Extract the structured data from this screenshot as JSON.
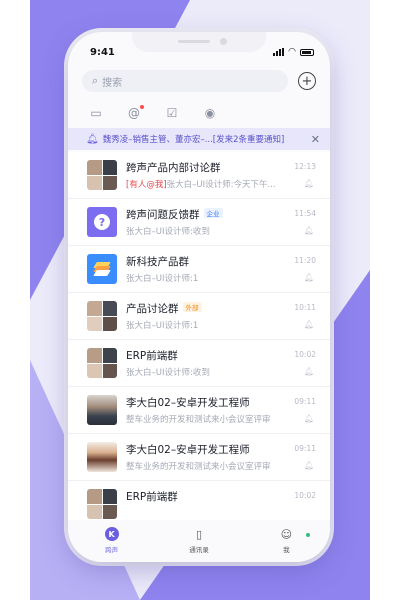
{
  "status_bar": {
    "time": "9:41"
  },
  "search": {
    "placeholder": "搜索",
    "icon": "search-icon"
  },
  "toolbar": {
    "icons": [
      "monitor-icon",
      "at-icon",
      "clipboard-check-icon",
      "eye-icon"
    ]
  },
  "notice": {
    "text": "魏秀凌–销售主管、董亦宏–...[发来2条重要通知]"
  },
  "conversations": [
    {
      "title": "跨声产品内部讨论群",
      "tag": "",
      "mention": "[有人@我]",
      "preview": "张大白–UI设计师:今天下午...",
      "time": "12:13",
      "avatar": "group"
    },
    {
      "title": "跨声问题反馈群",
      "tag": "企业",
      "mention": "",
      "preview": "张大白–UI设计师:收到",
      "time": "11:54",
      "avatar": "question"
    },
    {
      "title": "新科技产品群",
      "tag": "",
      "mention": "",
      "preview": "张大白–UI设计师:1",
      "time": "11:20",
      "avatar": "layers"
    },
    {
      "title": "产品讨论群",
      "tag": "外部",
      "mention": "",
      "preview": "张大白–UI设计师:1",
      "time": "10:11",
      "avatar": "group"
    },
    {
      "title": "ERP前端群",
      "tag": "",
      "mention": "",
      "preview": "张大白–UI设计师:收到",
      "time": "10:02",
      "avatar": "group"
    },
    {
      "title": "李大白02–安卓开发工程师",
      "tag": "",
      "mention": "",
      "preview": "整车业务的开发和测试来小会议室评审",
      "time": "09:11",
      "avatar": "person-male"
    },
    {
      "title": "李大白02–安卓开发工程师",
      "tag": "",
      "mention": "",
      "preview": "整车业务的开发和测试来小会议室评审",
      "time": "09:11",
      "avatar": "person-female"
    },
    {
      "title": "ERP前端群",
      "tag": "",
      "mention": "",
      "preview": "",
      "time": "10:02",
      "avatar": "group"
    }
  ],
  "tabbar": {
    "items": [
      {
        "label": "跨声",
        "icon": "K",
        "active": true
      },
      {
        "label": "通讯录",
        "icon": "contacts-icon",
        "active": false
      },
      {
        "label": "我",
        "icon": "user-icon",
        "active": false
      }
    ]
  },
  "colors": {
    "accent": "#6b5fe0",
    "mention": "#e5484d",
    "background_purple": "#8f83ef"
  }
}
